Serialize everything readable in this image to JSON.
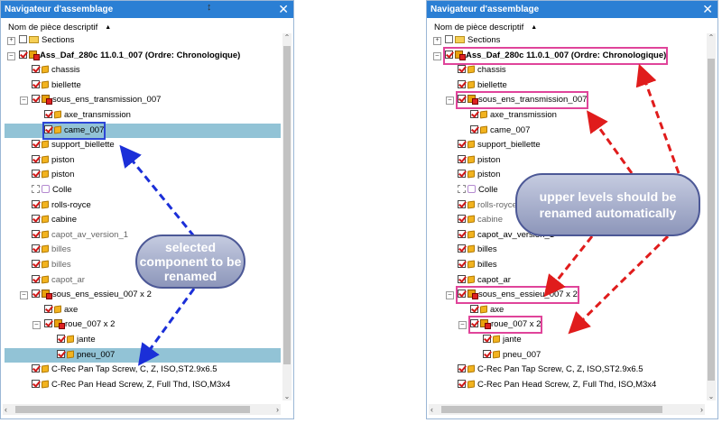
{
  "colors": {
    "titlebar": "#2b7fd4",
    "highlight": "#92c3d6",
    "check": "#d01818",
    "pink_annotation": "#e0449a",
    "blue_annotation": "#2c47d6",
    "arrow_red": "#e01c1c",
    "arrow_blue": "#1b2fd8"
  },
  "left": {
    "title": "Navigateur d'assemblage",
    "close": "✕",
    "header": "Nom de pièce descriptif",
    "sort": "▲",
    "callout": "selected component to be renamed",
    "rows": [
      {
        "label": "Sections",
        "check": "empty",
        "icon": "folder-icon",
        "exp": "+",
        "indent": 0
      },
      {
        "label": "Ass_Daf_280c 11.0.1_007 (Ordre: Chronologique)",
        "check": "on",
        "icon": "assembly-icon",
        "exp": "−",
        "indent": 0,
        "bold": true
      },
      {
        "label": "chassis",
        "check": "on",
        "icon": "part-icon",
        "indent": 1
      },
      {
        "label": "biellette",
        "check": "on",
        "icon": "part-icon",
        "indent": 1
      },
      {
        "label": "sous_ens_transmission_007",
        "check": "on",
        "icon": "assembly-icon",
        "exp": "−",
        "indent": 1
      },
      {
        "label": "axe_transmission",
        "check": "on",
        "icon": "part-icon",
        "indent": 2
      },
      {
        "label": "came_007",
        "check": "on",
        "icon": "part-icon",
        "indent": 2,
        "highlight": true,
        "box": "blue"
      },
      {
        "label": "support_biellette",
        "check": "on",
        "icon": "part-icon",
        "indent": 1
      },
      {
        "label": "piston",
        "check": "on",
        "icon": "part-icon",
        "indent": 1
      },
      {
        "label": "piston",
        "check": "on",
        "icon": "part-icon",
        "indent": 1
      },
      {
        "label": "Colle",
        "check": "dash",
        "icon": "ghost-icon",
        "indent": 1
      },
      {
        "label": "rolls-royce",
        "check": "on",
        "icon": "part-icon",
        "indent": 1
      },
      {
        "label": "cabine",
        "check": "on",
        "icon": "part-icon",
        "indent": 1
      },
      {
        "label": "capot_av_version_1",
        "check": "on",
        "icon": "part-icon",
        "indent": 1,
        "grey": true
      },
      {
        "label": "billes",
        "check": "on",
        "icon": "part-icon",
        "indent": 1,
        "grey": true
      },
      {
        "label": "billes",
        "check": "on",
        "icon": "part-icon",
        "indent": 1,
        "grey": true
      },
      {
        "label": "capot_ar",
        "check": "on",
        "icon": "part-icon",
        "indent": 1,
        "grey": true
      },
      {
        "label": "sous_ens_essieu_007 x 2",
        "check": "on",
        "icon": "assembly-icon",
        "exp": "−",
        "indent": 1
      },
      {
        "label": "axe",
        "check": "on",
        "icon": "part-icon",
        "indent": 2
      },
      {
        "label": "roue_007 x 2",
        "check": "on",
        "icon": "assembly-icon",
        "exp": "−",
        "indent": 2
      },
      {
        "label": "jante",
        "check": "on",
        "icon": "part-icon",
        "indent": 3
      },
      {
        "label": "pneu_007",
        "check": "on",
        "icon": "part-icon",
        "indent": 3,
        "highlight": true
      },
      {
        "label": "C-Rec Pan Tap Screw, C, Z, ISO,ST2.9x6.5",
        "check": "on",
        "icon": "part-icon",
        "indent": 1
      },
      {
        "label": "C-Rec Pan Head Screw, Z, Full Thd, ISO,M3x4",
        "check": "on",
        "icon": "part-icon",
        "indent": 1
      }
    ]
  },
  "right": {
    "title": "Navigateur d'assemblage",
    "close": "✕",
    "header": "Nom de pièce descriptif",
    "sort": "▲",
    "callout": "upper levels should be renamed automatically",
    "rows": [
      {
        "label": "Sections",
        "check": "empty",
        "icon": "folder-icon",
        "exp": "+",
        "indent": 0
      },
      {
        "label": "Ass_Daf_280c 11.0.1_007 (Ordre: Chronologique)",
        "check": "on",
        "icon": "assembly-icon",
        "exp": "−",
        "indent": 0,
        "bold": true,
        "box": "pink"
      },
      {
        "label": "chassis",
        "check": "on",
        "icon": "part-icon",
        "indent": 1
      },
      {
        "label": "biellette",
        "check": "on",
        "icon": "part-icon",
        "indent": 1
      },
      {
        "label": "sous_ens_transmission_007",
        "check": "on",
        "icon": "assembly-icon",
        "exp": "−",
        "indent": 1,
        "box": "pink"
      },
      {
        "label": "axe_transmission",
        "check": "on",
        "icon": "part-icon",
        "indent": 2
      },
      {
        "label": "came_007",
        "check": "on",
        "icon": "part-icon",
        "indent": 2
      },
      {
        "label": "support_biellette",
        "check": "on",
        "icon": "part-icon",
        "indent": 1
      },
      {
        "label": "piston",
        "check": "on",
        "icon": "part-icon",
        "indent": 1
      },
      {
        "label": "piston",
        "check": "on",
        "icon": "part-icon",
        "indent": 1
      },
      {
        "label": "Colle",
        "check": "dash",
        "icon": "ghost-icon",
        "indent": 1
      },
      {
        "label": "rolls-royce",
        "check": "on",
        "icon": "part-icon",
        "indent": 1,
        "grey": true
      },
      {
        "label": "cabine",
        "check": "on",
        "icon": "part-icon",
        "indent": 1,
        "grey": true
      },
      {
        "label": "capot_av_version_1",
        "check": "on",
        "icon": "part-icon",
        "indent": 1
      },
      {
        "label": "billes",
        "check": "on",
        "icon": "part-icon",
        "indent": 1
      },
      {
        "label": "billes",
        "check": "on",
        "icon": "part-icon",
        "indent": 1
      },
      {
        "label": "capot_ar",
        "check": "on",
        "icon": "part-icon",
        "indent": 1
      },
      {
        "label": "sous_ens_essieu_007 x 2",
        "check": "on",
        "icon": "assembly-icon",
        "exp": "−",
        "indent": 1,
        "box": "pink"
      },
      {
        "label": "axe",
        "check": "on",
        "icon": "part-icon",
        "indent": 2
      },
      {
        "label": "roue_007 x 2",
        "check": "on",
        "icon": "assembly-icon",
        "exp": "−",
        "indent": 2,
        "box": "pink"
      },
      {
        "label": "jante",
        "check": "on",
        "icon": "part-icon",
        "indent": 3
      },
      {
        "label": "pneu_007",
        "check": "on",
        "icon": "part-icon",
        "indent": 3
      },
      {
        "label": "C-Rec Pan Tap Screw, C, Z, ISO,ST2.9x6.5",
        "check": "on",
        "icon": "part-icon",
        "indent": 1
      },
      {
        "label": "C-Rec Pan Head Screw, Z, Full Thd, ISO,M3x4",
        "check": "on",
        "icon": "part-icon",
        "indent": 1
      }
    ]
  }
}
